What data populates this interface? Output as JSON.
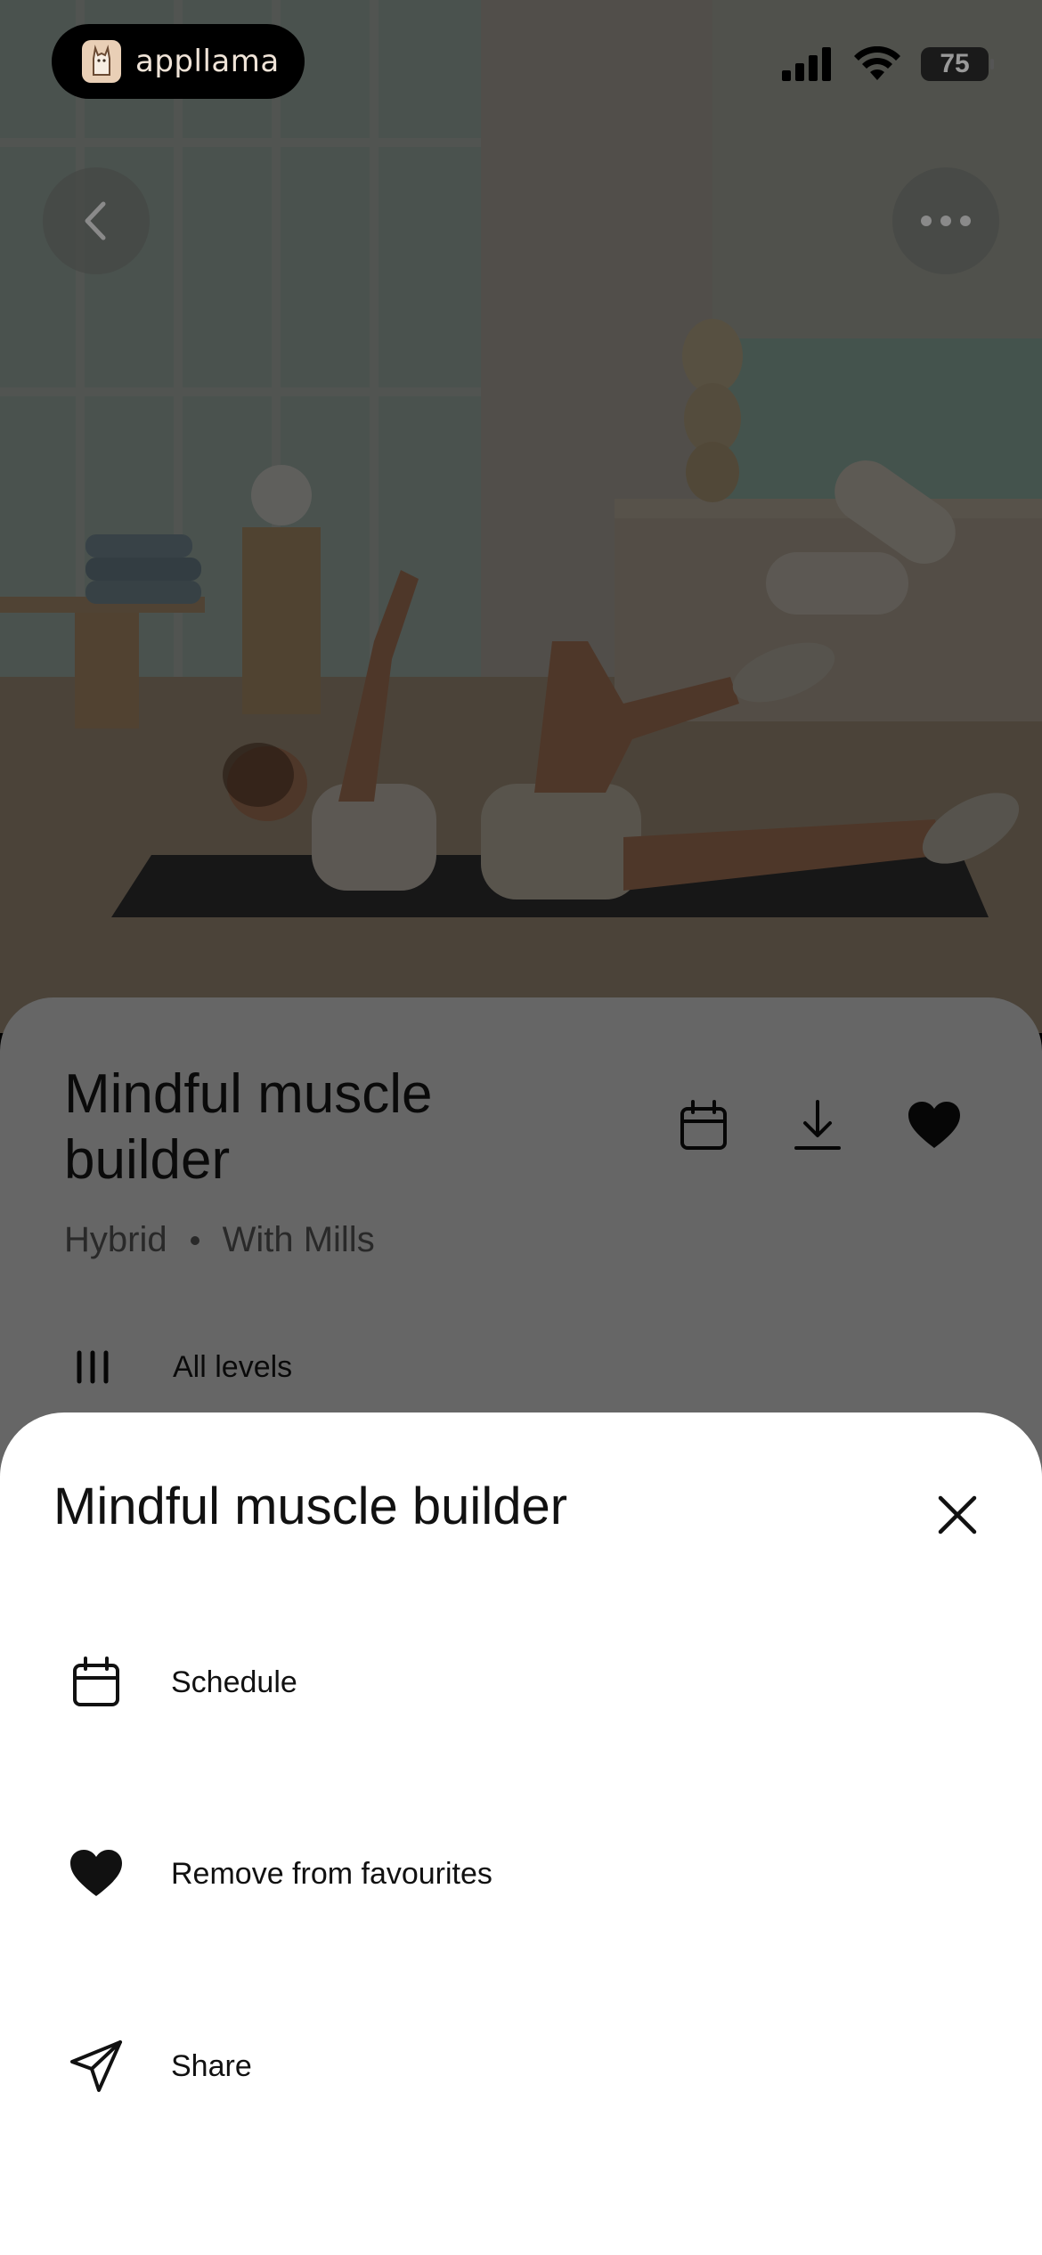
{
  "status_bar": {
    "app_name": "appllama",
    "battery": "75",
    "icons": [
      "signal-icon",
      "wifi-icon",
      "battery-icon"
    ]
  },
  "hero": {
    "icons": [
      "back-chevron-icon",
      "more-dots-icon"
    ]
  },
  "workout": {
    "title": "Mindful muscle builder",
    "category": "Hybrid",
    "instructor": "With Mills",
    "level": "All levels",
    "actions": [
      "calendar-icon",
      "download-icon",
      "heart-icon"
    ]
  },
  "sheet": {
    "title": "Mindful muscle builder",
    "close_icon": "close-icon",
    "items": [
      {
        "label": "Schedule",
        "icon": "calendar-icon"
      },
      {
        "label": "Remove from favourites",
        "icon": "heart-icon"
      },
      {
        "label": "Share",
        "icon": "send-icon"
      }
    ]
  },
  "colors": {
    "sheet_bg": "#ffffff",
    "text": "#111111",
    "scrim": "rgba(0,0,0,0.6)",
    "app_pill": "#000000"
  }
}
